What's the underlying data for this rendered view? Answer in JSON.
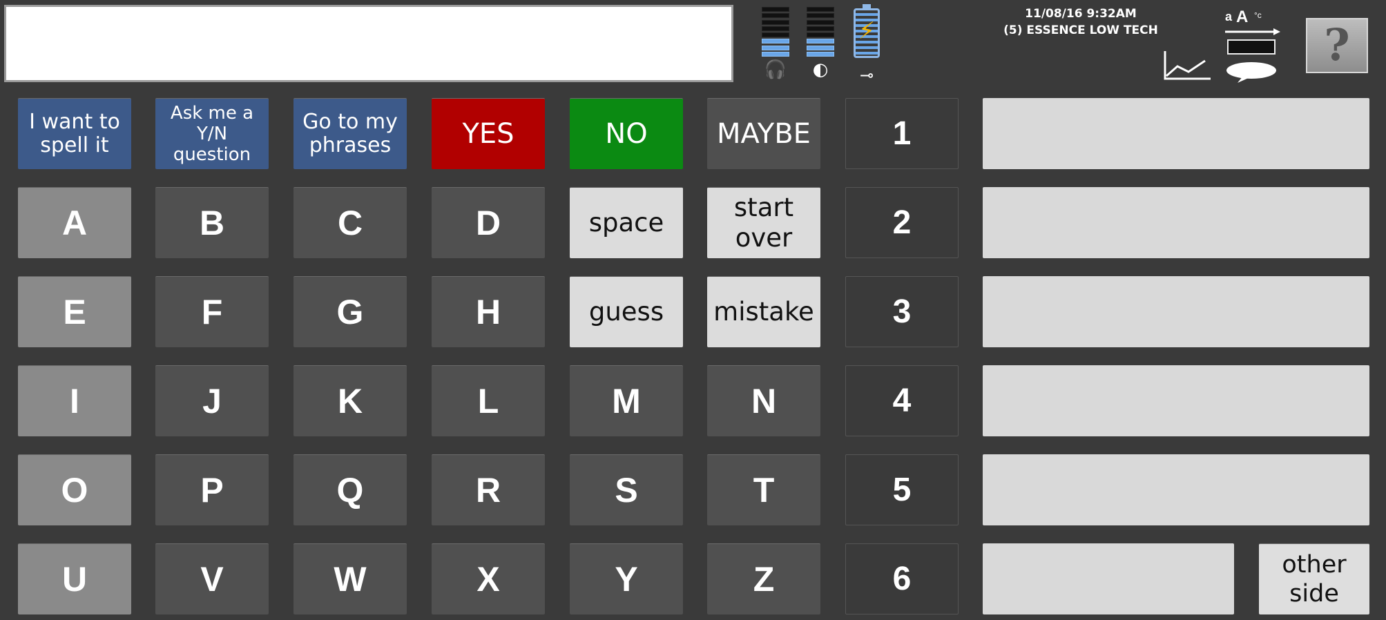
{
  "status": {
    "datetime": "11/08/16 9:32AM",
    "profile": "(5) ESSENCE LOW TECH",
    "help_label": "?"
  },
  "meters": {
    "headphone_level": 0.4,
    "speaker_level": 0.4,
    "battery_level": 1.0
  },
  "message": {
    "value": ""
  },
  "quick_buttons": {
    "spell_line1": "I want to",
    "spell_line2": "spell it",
    "ask_line1": "Ask me a",
    "ask_line2": "Y/N",
    "ask_line3": "question",
    "phrases_line1": "Go to my",
    "phrases_line2": "phrases",
    "yes": "YES",
    "no": "NO",
    "maybe": "MAYBE"
  },
  "letters": [
    "A",
    "B",
    "C",
    "D",
    "E",
    "F",
    "G",
    "H",
    "I",
    "J",
    "K",
    "L",
    "M",
    "N",
    "O",
    "P",
    "Q",
    "R",
    "S",
    "T",
    "U",
    "V",
    "W",
    "X",
    "Y",
    "Z"
  ],
  "actions": {
    "space": "space",
    "start_over_line1": "start",
    "start_over_line2": "over",
    "guess": "guess",
    "mistake": "mistake"
  },
  "numbers": [
    "1",
    "2",
    "3",
    "4",
    "5",
    "6"
  ],
  "other_side_line1": "other",
  "other_side_line2": "side",
  "colors": {
    "background": "#3a3a3a",
    "blue_button": "#3d5a8a",
    "yes": "#b10000",
    "no": "#0b8a12",
    "meter": "#6aa6e8",
    "bolt": "#f3b400"
  },
  "icons": [
    "headphones-icon",
    "speaker-icon",
    "battery-icon",
    "plug-icon",
    "graph-icon",
    "text-size-icon",
    "help-icon"
  ]
}
